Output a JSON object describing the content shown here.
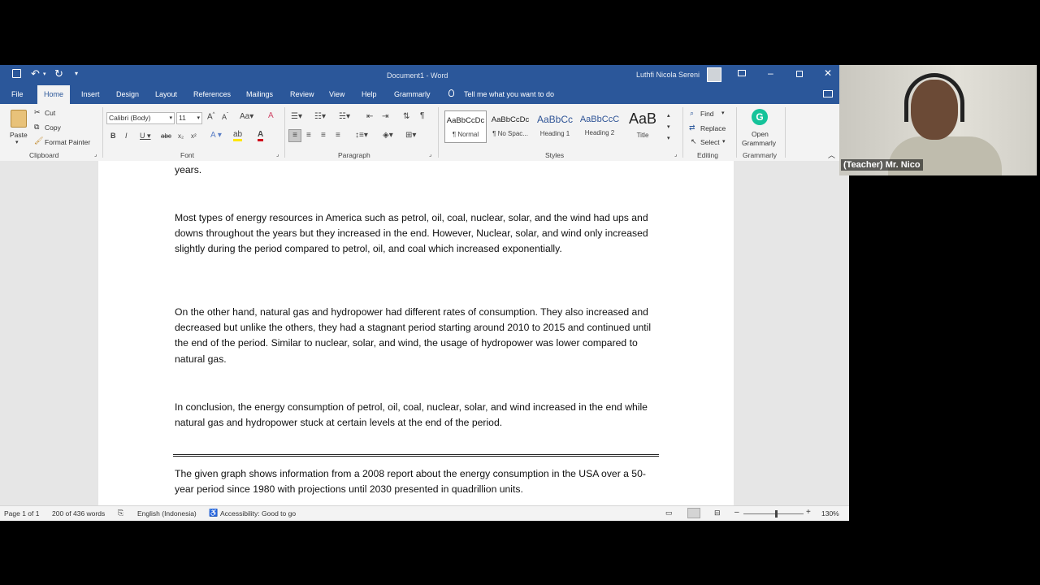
{
  "titlebar": {
    "doc_title": "Document1  -  Word",
    "user": "Luthfi Nicola Sereni"
  },
  "tabs": [
    "File",
    "Home",
    "Insert",
    "Design",
    "Layout",
    "References",
    "Mailings",
    "Review",
    "View",
    "Help",
    "Grammarly"
  ],
  "tell_me": "Tell me what you want to do",
  "clipboard": {
    "paste": "Paste",
    "cut": "Cut",
    "copy": "Copy",
    "format_painter": "Format Painter",
    "label": "Clipboard"
  },
  "font": {
    "name": "Calibri (Body)",
    "size": "11",
    "label": "Font"
  },
  "paragraph": {
    "label": "Paragraph"
  },
  "styles": {
    "label": "Styles",
    "items": [
      {
        "preview": "AaBbCcDc",
        "name": "¶ Normal"
      },
      {
        "preview": "AaBbCcDc",
        "name": "¶ No Spac..."
      },
      {
        "preview": "AaBbCc",
        "name": "Heading 1"
      },
      {
        "preview": "AaBbCcC",
        "name": "Heading 2"
      },
      {
        "preview": "AaB",
        "name": "Title"
      }
    ]
  },
  "editing": {
    "find": "Find",
    "replace": "Replace",
    "select": "Select",
    "label": "Editing"
  },
  "grammarly": {
    "open": "Open",
    "grammarly": "Grammarly",
    "label": "Grammarly"
  },
  "document": {
    "p0": "years.",
    "p1": "Most types of energy resources in America such as petrol, oil, coal, nuclear, solar, and the wind had ups and downs throughout the years but they increased in the end. However, Nuclear, solar, and wind only increased slightly during the period compared to petrol, oil, and coal which increased exponentially.",
    "p2": "On the other hand, natural gas and hydropower had different rates of consumption. They also increased and decreased but unlike the others, they had a stagnant period starting around 2010 to 2015 and continued until the end of the period. Similar to nuclear, solar, and wind, the usage of hydropower was lower compared to natural gas.",
    "p3": "In conclusion, the energy consumption of petrol, oil, coal, nuclear, solar, and wind increased in the end while natural gas and hydropower stuck at certain levels at the end of the period.",
    "p4": "The given graph shows information from a 2008 report about the energy consumption in the USA over a 50-year period since 1980 with projections until 2030 presented in quadrillion units."
  },
  "status": {
    "page": "Page 1 of 1",
    "words": "200 of 436 words",
    "language": "English (Indonesia)",
    "accessibility": "Accessibility: Good to go",
    "zoom": "130%"
  },
  "zoom_percent": 130,
  "webcam": {
    "label": "(Teacher) Mr. Nico"
  },
  "colors": {
    "word_blue": "#2b579a",
    "grammarly_green": "#15c39a"
  }
}
